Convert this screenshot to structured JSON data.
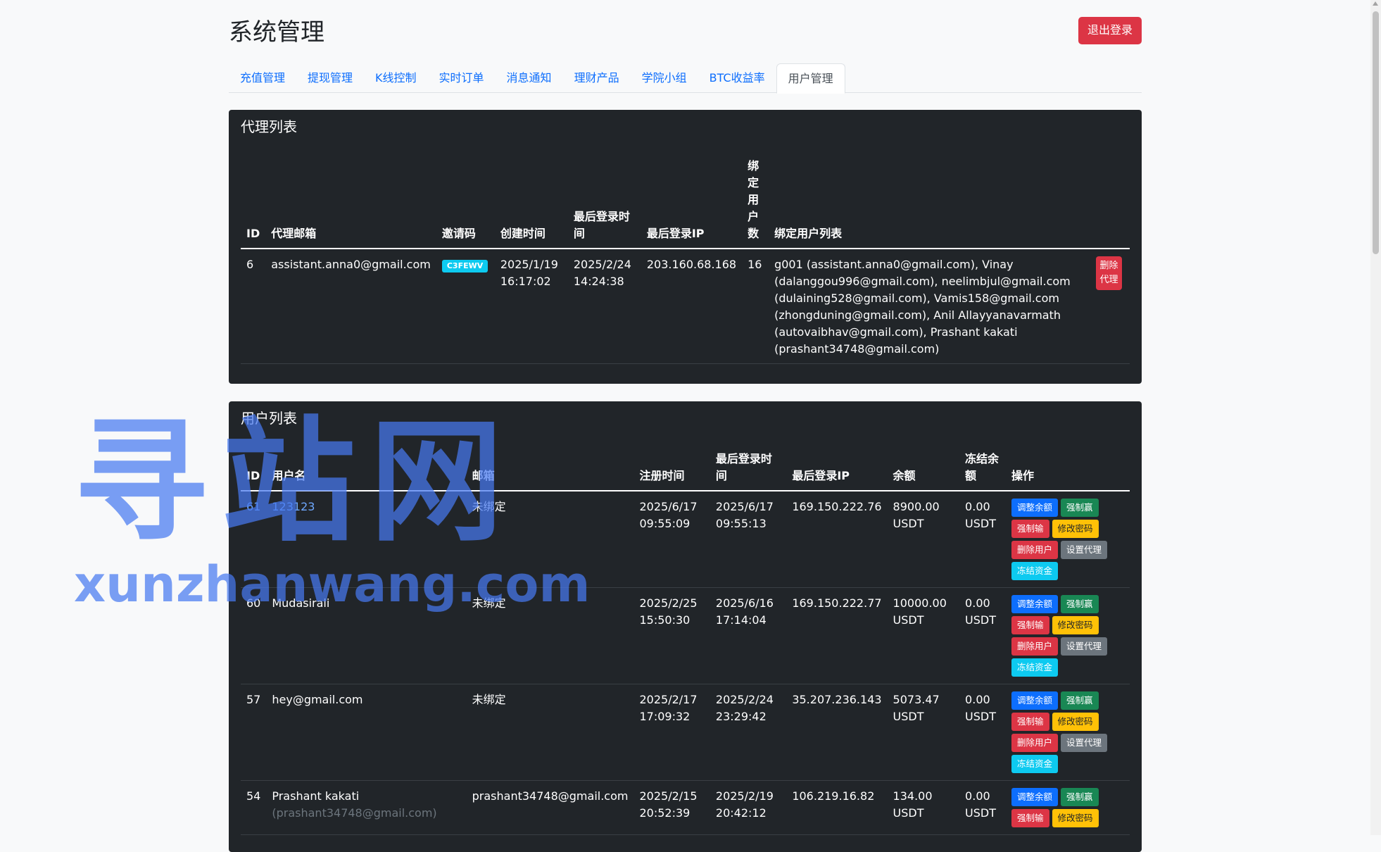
{
  "header": {
    "title": "系统管理",
    "logout_label": "退出登录"
  },
  "tabs": [
    "充值管理",
    "提现管理",
    "K线控制",
    "实时订单",
    "消息通知",
    "理财产品",
    "学院小组",
    "BTC收益率",
    "用户管理"
  ],
  "active_tab": "用户管理",
  "agents": {
    "title": "代理列表",
    "headers": {
      "id": "ID",
      "email": "代理邮箱",
      "invite": "邀请码",
      "created": "创建时间",
      "last_login": "最后登录时间",
      "last_ip": "最后登录IP",
      "bound_count": "绑定用户数",
      "bound_list": "绑定用户列表"
    },
    "rows": [
      {
        "id": "6",
        "email": "assistant.anna0@gmail.com",
        "invite": "C3FEWV",
        "created": "2025/1/19 16:17:02",
        "last_login": "2025/2/24 14:24:38",
        "last_ip": "203.160.68.168",
        "bound_count": "16",
        "bound_list": "g001 (assistant.anna0@gmail.com), Vinay (dalanggou996@gmail.com), neelimbjul@gmail.com (dulaining528@gmail.com), Vamis158@gmail.com (zhongduning@gmail.com), Anil Allayyanavarmath (autovaibhav@gmail.com), Prashant kakati (prashant34748@gmail.com)",
        "delete_label": "删除代理"
      }
    ]
  },
  "users": {
    "title": "用户列表",
    "headers": {
      "id": "ID",
      "username": "用户名",
      "email": "邮箱",
      "registered": "注册时间",
      "last_login": "最后登录时间",
      "last_ip": "最后登录IP",
      "balance": "余额",
      "frozen": "冻结余额",
      "actions": "操作"
    },
    "actions": {
      "adjust": "调整余额",
      "force_win": "强制赢",
      "force_lose": "强制输",
      "change_pwd": "修改密码",
      "delete": "删除用户",
      "set_agent": "设置代理",
      "freeze": "冻结资金"
    },
    "rows": [
      {
        "id": "61",
        "username": "123123",
        "email": "未绑定",
        "registered": "2025/6/17 09:55:09",
        "last_login": "2025/6/17 09:55:13",
        "last_ip": "169.150.222.76",
        "balance": "8900.00 USDT",
        "frozen": "0.00 USDT"
      },
      {
        "id": "60",
        "username": "Mudasirali",
        "email": "未绑定",
        "registered": "2025/2/25 15:50:30",
        "last_login": "2025/6/16 17:14:04",
        "last_ip": "169.150.222.77",
        "balance": "10000.00 USDT",
        "frozen": "0.00 USDT"
      },
      {
        "id": "57",
        "username": "hey@gmail.com",
        "email": "未绑定",
        "registered": "2025/2/17 17:09:32",
        "last_login": "2025/2/24 23:29:42",
        "last_ip": "35.207.236.143",
        "balance": "5073.47 USDT",
        "frozen": "0.00 USDT"
      },
      {
        "id": "54",
        "username": "Prashant kakati",
        "username_sub": "(prashant34748@gmail.com)",
        "email": "prashant34748@gmail.com",
        "registered": "2025/2/15 20:52:39",
        "last_login": "2025/2/19 20:42:12",
        "last_ip": "106.219.16.82",
        "balance": "134.00 USDT",
        "frozen": "0.00 USDT"
      }
    ]
  },
  "watermark": {
    "cn": "寻站网",
    "en": "xunzhanwang.com"
  }
}
